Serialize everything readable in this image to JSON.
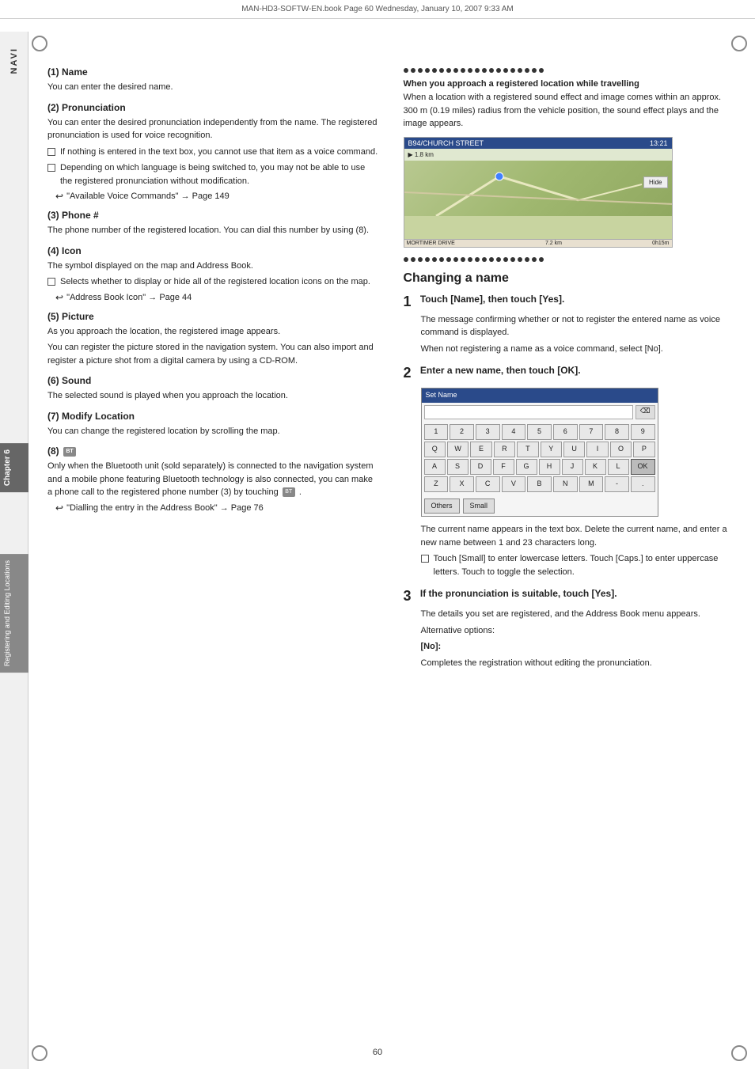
{
  "header": {
    "text": "MAN-HD3-SOFTW-EN.book  Page 60  Wednesday, January 10, 2007  9:33 AM"
  },
  "sidebar": {
    "navi_label": "NAVI",
    "chapter_label": "Chapter 6",
    "reg_edit_label": "Registering and Editing Locations"
  },
  "left_column": {
    "section1": {
      "title": "(1) Name",
      "body": "You can enter the desired name."
    },
    "section2": {
      "title": "(2) Pronunciation",
      "body": "You can enter the desired pronunciation independently from the name. The registered pronunciation is used for voice recognition.",
      "bullets": [
        "If nothing is entered in the text box, you cannot use that item as a voice command.",
        "Depending on which language is being switched to, you may not be able to use the registered pronunciation without modification."
      ],
      "ref": "\"Available Voice Commands\" → Page 149"
    },
    "section3": {
      "title": "(3) Phone #",
      "body": "The phone number of the registered location. You can dial this number by using (8)."
    },
    "section4": {
      "title": "(4) Icon",
      "body": "The symbol displayed on the map and Address Book.",
      "bullets": [
        "Selects whether to display or hide all of the registered location icons on the map."
      ],
      "ref": "\"Address Book Icon\" → Page 44"
    },
    "section5": {
      "title": "(5) Picture",
      "body1": "As you approach the location, the registered image appears.",
      "body2": "You can register the picture stored in the navigation system. You can also import and register a picture shot from a digital camera by using a CD-ROM."
    },
    "section6": {
      "title": "(6) Sound",
      "body": "The selected sound is played when you approach the location."
    },
    "section7": {
      "title": "(7) Modify Location",
      "body": "You can change the registered location by scrolling the map."
    },
    "section8": {
      "title": "(8)",
      "body": "Only when the Bluetooth unit (sold separately) is connected to the navigation system and a mobile phone featuring Bluetooth technology is also connected, you can make a phone call to the registered phone number (3) by touching",
      "body2": ".",
      "ref": "\"Dialling the entry in the Address Book\" → Page 76"
    }
  },
  "right_column": {
    "dot_divider_count": 20,
    "section_title": "When you approach a registered location while travelling",
    "body1": "When a location with a registered sound effect and image comes within an approx. 300 m (0.19 miles) radius from the vehicle position, the sound effect plays and the image appears.",
    "nav_screenshot": {
      "top_bar_left": "B94/CHURCH STREET",
      "top_bar_right": "13:21",
      "distance": "1.8 km",
      "hide_btn": "Hide",
      "road_info_line1": "7.2 km",
      "road_info_line2": "0h15m",
      "bottom_road": "MORTIMER DRIVE"
    },
    "changing_name": {
      "title": "Changing a name",
      "step1": {
        "number": "1",
        "title": "Touch [Name], then touch [Yes].",
        "body1": "The message confirming whether or not to register the entered name as voice command is displayed.",
        "body2": "When not registering a name as a voice command, select [No]."
      },
      "step2": {
        "number": "2",
        "title": "Enter a new name, then touch [OK].",
        "keyboard": {
          "title": "Set Name",
          "keys_row1": [
            "1",
            "2",
            "3",
            "4",
            "5",
            "6",
            "7",
            "8",
            "9"
          ],
          "keys_row2": [
            "Q",
            "W",
            "E",
            "R",
            "T",
            "Y",
            "U",
            "I",
            "O",
            "P"
          ],
          "keys_row3": [
            "A",
            "S",
            "D",
            "F",
            "G",
            "H",
            "J",
            "K",
            "L"
          ],
          "keys_row4": [
            "Z",
            "X",
            "C",
            "V",
            "B",
            "N",
            "M",
            "-",
            "."
          ],
          "btn_others": "Others",
          "btn_small": "Small",
          "btn_ok": "OK"
        },
        "body1": "The current name appears in the text box. Delete the current name, and enter a new name between 1 and 23 characters long.",
        "bullets": [
          "Touch [Small] to enter lowercase letters. Touch [Caps.] to enter uppercase letters. Touch to toggle the selection."
        ]
      },
      "step3": {
        "number": "3",
        "title": "If the pronunciation is suitable, touch [Yes].",
        "body1": "The details you set are registered, and the Address Book menu appears.",
        "body2": "Alternative options:",
        "no_label": "[No]:",
        "no_body": "Completes the registration without editing the pronunciation."
      }
    }
  },
  "page_number": "60"
}
